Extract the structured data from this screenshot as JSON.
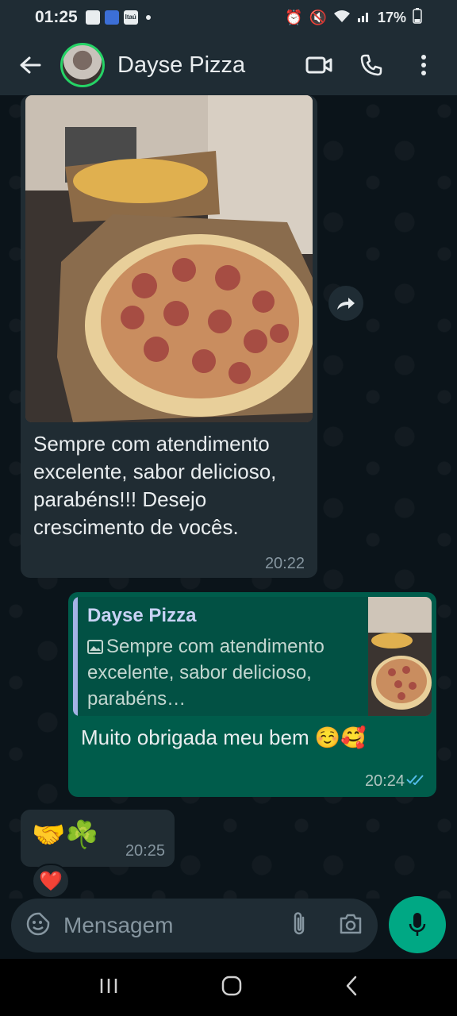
{
  "status_bar": {
    "time": "01:25",
    "carrier_label": "Itaú",
    "battery": "17%"
  },
  "header": {
    "contact_name": "Dayse Pizza"
  },
  "messages": {
    "incoming1": {
      "text": "Sempre com atendimento excelente, sabor delicioso, parabéns!!! Desejo crescimento de vocês.",
      "time": "20:22"
    },
    "outgoing1": {
      "quote_name": "Dayse Pizza",
      "quote_text": "Sempre com atendimento excelente, sabor delicioso, parabéns…",
      "text": "Muito obrigada meu bem ☺️🥰",
      "time": "20:24"
    },
    "incoming2": {
      "text": "🤝☘️",
      "time": "20:25",
      "reaction": "❤️"
    }
  },
  "composer": {
    "placeholder": "Mensagem"
  },
  "colors": {
    "accent": "#00a884",
    "outgoing_bubble": "#005c4b",
    "incoming_bubble": "#202c33"
  }
}
